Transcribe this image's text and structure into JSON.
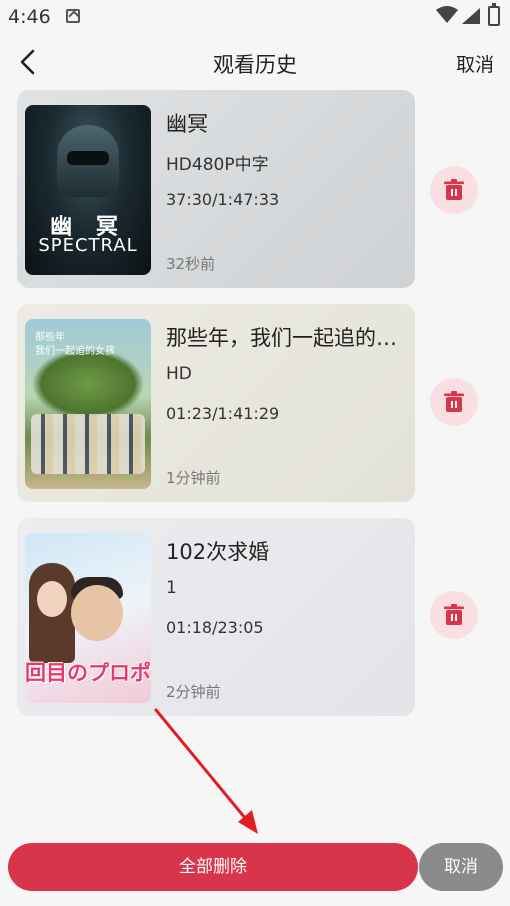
{
  "status_bar": {
    "time": "4:46"
  },
  "header": {
    "title": "观看历史",
    "cancel_label": "取消"
  },
  "history": [
    {
      "title": "幽冥",
      "quality": "HD480P中字",
      "progress": "37:30/1:47:33",
      "watched_ago": "32秒前",
      "poster_text_cn": "幽 冥",
      "poster_text_en": "SPECTRAL"
    },
    {
      "title": "那些年，我们一起追的女孩",
      "quality": "HD",
      "progress": "01:23/1:41:29",
      "watched_ago": "1分钟前",
      "poster_text_cn": "那些年\n我们一起追的女孩"
    },
    {
      "title": "102次求婚",
      "quality": "1",
      "progress": "01:18/23:05",
      "watched_ago": "2分钟前",
      "poster_text_jp": "回目のプロポ"
    }
  ],
  "bottom_bar": {
    "delete_all_label": "全部删除",
    "cancel_label": "取消"
  },
  "colors": {
    "accent": "#d8354a",
    "delete_icon": "#d8354a",
    "delete_bg": "#f9dfe1",
    "cancel_btn": "#8a8a8a",
    "annotation_arrow": "#e02020"
  },
  "icons": {
    "back": "chevron-left-icon",
    "delete": "trash-icon",
    "annotation": "red-arrow-annotation"
  }
}
